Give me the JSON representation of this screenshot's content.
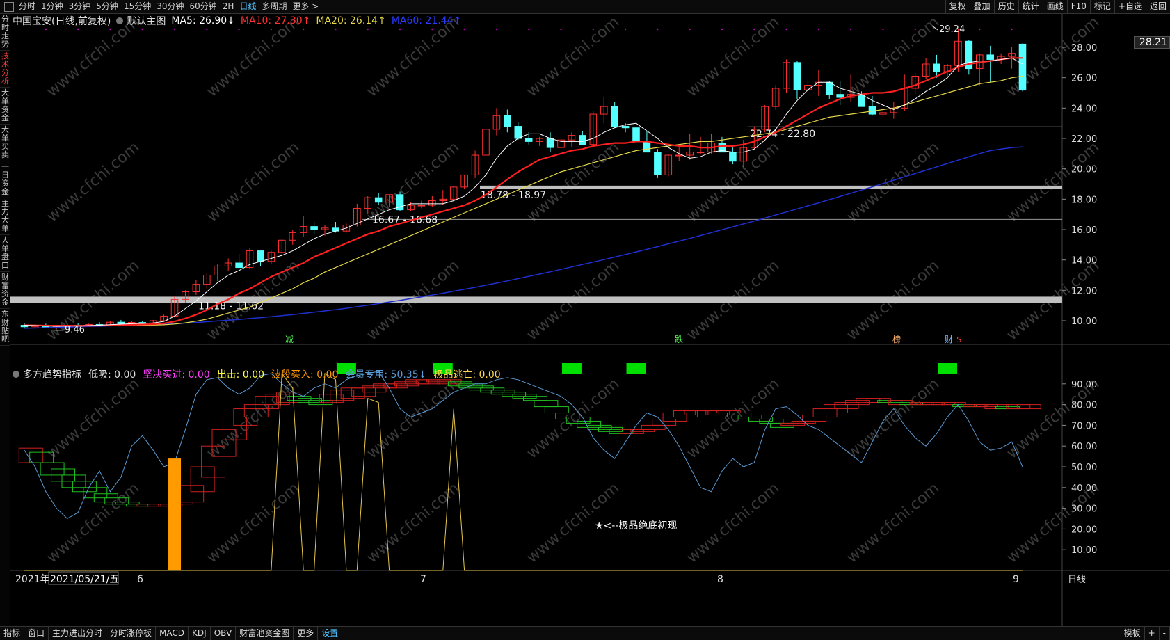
{
  "toolbar": {
    "periods": [
      "分时",
      "1分钟",
      "3分钟",
      "5分钟",
      "15分钟",
      "30分钟",
      "60分钟",
      "2H",
      "日线",
      "多周期",
      "更多 >"
    ],
    "active_period": "日线",
    "tools": [
      "复权",
      "叠加",
      "历史",
      "统计",
      "画线",
      "F10",
      "标记",
      "+自选",
      "返回"
    ]
  },
  "left_nav": [
    "分时走势",
    "技术分析",
    "大单资金",
    "大单买卖",
    "一日资金",
    "主力大单",
    "大单盘口",
    "财富资金",
    "东财贴吧"
  ],
  "left_nav_active": "技术分析",
  "main_legend": {
    "title": "中国宝安(日线,前复权)",
    "overlay": "默认主图",
    "ma5": "MA5: 26.90↓",
    "ma10": "MA10: 27.30↑",
    "ma20": "MA20: 26.14↑",
    "ma60": "MA60: 21.44↑"
  },
  "sub_legend": {
    "name": "多方趋势指标",
    "low": "低吸: 0.00",
    "firm_buy": "坚决买进: 0.00",
    "exit": "出击: 0.00",
    "wave_buy": "波段买入: 0.00",
    "member": "会员专用: 50.35↓",
    "escape": "极品逃亡: 0.00"
  },
  "last_price": "28.21",
  "colors": {
    "up": "#ff3030",
    "down": "#54ffff",
    "ma5": "#ffffff",
    "ma10": "#ff2020",
    "ma20": "#e6d84a",
    "ma60": "#1f2fd0",
    "orange": "#ff9a00",
    "green": "#00e000",
    "blue": "#5b9bd5"
  },
  "price_axis": [
    "28.00",
    "26.00",
    "24.00",
    "22.00",
    "20.00",
    "18.00",
    "16.00",
    "14.00",
    "12.00",
    "10.00"
  ],
  "sub_axis": [
    "90.00",
    "80.00",
    "70.00",
    "60.00",
    "50.00",
    "40.00",
    "30.00",
    "20.00",
    "10.00"
  ],
  "date_labels": {
    "start": "2021年",
    "date": "2021/05/21/五",
    "m6": "6",
    "m7": "7",
    "m8": "8",
    "m9": "9",
    "period": "日线"
  },
  "range_labels": [
    "11.18 - 11.62",
    "16.67 - 16.68",
    "18.78 - 18.97",
    "22.74 - 22.80"
  ],
  "extrema": {
    "high": "29.24",
    "low": "9.46"
  },
  "event_markers": [
    "减",
    "跌",
    "榜",
    "财",
    "$"
  ],
  "annotation": "★<--极品绝底初现",
  "watermark": "www.cfchi.com",
  "bottom_tabs": [
    "指标",
    "窗口",
    "主力进出分时",
    "分时涨停板",
    "MACD",
    "KDJ",
    "OBV",
    "财富池资金图",
    "更多",
    "设置"
  ],
  "bottom_active": "设置",
  "bottom_right": [
    "模板",
    "+",
    "-"
  ],
  "chart_data": {
    "type": "candlestick",
    "candles": [
      [
        9.7,
        9.85,
        9.55,
        9.6
      ],
      [
        9.6,
        9.75,
        9.5,
        9.7
      ],
      [
        9.7,
        9.8,
        9.5,
        9.55
      ],
      [
        9.55,
        9.7,
        9.46,
        9.62
      ],
      [
        9.62,
        9.78,
        9.55,
        9.7
      ],
      [
        9.7,
        9.82,
        9.6,
        9.66
      ],
      [
        9.66,
        9.8,
        9.6,
        9.75
      ],
      [
        9.75,
        9.9,
        9.65,
        9.72
      ],
      [
        9.72,
        9.95,
        9.68,
        9.9
      ],
      [
        9.9,
        10.05,
        9.75,
        9.8
      ],
      [
        9.8,
        9.95,
        9.7,
        9.88
      ],
      [
        9.88,
        10.0,
        9.75,
        9.82
      ],
      [
        9.82,
        10.05,
        9.8,
        10.0
      ],
      [
        10.0,
        10.4,
        9.95,
        10.3
      ],
      [
        10.3,
        11.6,
        10.2,
        11.4
      ],
      [
        11.4,
        12.0,
        11.2,
        11.9
      ],
      [
        11.9,
        12.7,
        11.7,
        12.4
      ],
      [
        12.4,
        13.1,
        12.1,
        13.0
      ],
      [
        13.0,
        13.7,
        12.6,
        13.6
      ],
      [
        13.6,
        14.1,
        13.3,
        13.8
      ],
      [
        13.8,
        14.4,
        13.5,
        13.5
      ],
      [
        13.5,
        14.8,
        13.4,
        14.6
      ],
      [
        14.6,
        14.6,
        13.6,
        13.9
      ],
      [
        13.9,
        14.6,
        13.7,
        14.5
      ],
      [
        14.5,
        15.4,
        14.3,
        15.3
      ],
      [
        15.3,
        16.0,
        15.0,
        15.8
      ],
      [
        15.8,
        16.9,
        15.5,
        16.2
      ],
      [
        16.2,
        16.5,
        15.7,
        16.0
      ],
      [
        16.0,
        16.3,
        15.6,
        16.1
      ],
      [
        16.1,
        16.5,
        15.8,
        15.9
      ],
      [
        15.9,
        16.4,
        15.8,
        16.3
      ],
      [
        16.3,
        17.7,
        16.2,
        17.4
      ],
      [
        17.4,
        18.2,
        17.0,
        18.1
      ],
      [
        18.1,
        18.4,
        17.6,
        17.8
      ],
      [
        17.8,
        18.3,
        17.5,
        18.3
      ],
      [
        18.3,
        18.5,
        17.2,
        17.3
      ],
      [
        17.3,
        17.8,
        17.2,
        17.6
      ],
      [
        17.6,
        17.9,
        17.4,
        17.6
      ],
      [
        17.6,
        18.2,
        17.5,
        17.9
      ],
      [
        17.9,
        18.6,
        17.6,
        18.0
      ],
      [
        18.0,
        18.9,
        17.8,
        18.8
      ],
      [
        18.8,
        19.6,
        18.7,
        19.6
      ],
      [
        19.6,
        21.2,
        19.4,
        20.9
      ],
      [
        20.9,
        23.0,
        20.6,
        22.6
      ],
      [
        22.6,
        24.0,
        22.2,
        23.5
      ],
      [
        23.5,
        23.9,
        22.4,
        22.8
      ],
      [
        22.8,
        23.1,
        21.9,
        22.0
      ],
      [
        22.0,
        22.4,
        21.6,
        21.8
      ],
      [
        21.8,
        22.1,
        21.5,
        22.0
      ],
      [
        22.0,
        22.4,
        21.1,
        21.4
      ],
      [
        21.4,
        22.2,
        20.8,
        21.9
      ],
      [
        21.9,
        22.4,
        21.4,
        22.2
      ],
      [
        22.2,
        22.5,
        21.6,
        21.6
      ],
      [
        21.6,
        23.8,
        21.4,
        23.6
      ],
      [
        23.6,
        24.7,
        23.0,
        24.1
      ],
      [
        24.1,
        24.4,
        22.7,
        22.8
      ],
      [
        22.8,
        23.0,
        22.4,
        22.7
      ],
      [
        22.7,
        23.2,
        21.6,
        21.8
      ],
      [
        21.8,
        22.5,
        21.1,
        21.1
      ],
      [
        21.1,
        21.3,
        19.4,
        19.6
      ],
      [
        19.6,
        21.0,
        19.5,
        20.9
      ],
      [
        20.9,
        21.4,
        20.5,
        20.9
      ],
      [
        20.9,
        22.3,
        20.6,
        21.1
      ],
      [
        21.1,
        22.1,
        21.0,
        21.1
      ],
      [
        21.1,
        22.3,
        21.0,
        21.7
      ],
      [
        21.7,
        22.1,
        21.1,
        21.1
      ],
      [
        21.1,
        21.4,
        20.3,
        20.5
      ],
      [
        20.5,
        21.9,
        20.0,
        21.4
      ],
      [
        21.4,
        22.8,
        21.3,
        22.6
      ],
      [
        22.6,
        24.2,
        22.4,
        24.1
      ],
      [
        24.1,
        25.5,
        23.9,
        25.3
      ],
      [
        25.3,
        27.2,
        25.0,
        27.0
      ],
      [
        27.0,
        27.1,
        24.6,
        25.2
      ],
      [
        25.2,
        25.9,
        25.0,
        25.5
      ],
      [
        25.5,
        26.5,
        24.8,
        25.7
      ],
      [
        25.7,
        25.8,
        24.6,
        24.9
      ],
      [
        24.9,
        25.8,
        24.2,
        24.7
      ],
      [
        24.7,
        26.2,
        24.4,
        24.9
      ],
      [
        24.9,
        25.1,
        24.1,
        24.1
      ],
      [
        24.1,
        24.8,
        23.5,
        23.6
      ],
      [
        23.6,
        23.8,
        23.4,
        23.7
      ],
      [
        23.7,
        24.4,
        23.3,
        24.0
      ],
      [
        24.0,
        26.2,
        23.8,
        25.3
      ],
      [
        25.3,
        26.3,
        24.9,
        26.1
      ],
      [
        26.1,
        27.3,
        25.9,
        26.9
      ],
      [
        26.9,
        27.5,
        26.0,
        26.4
      ],
      [
        26.4,
        26.9,
        26.0,
        26.8
      ],
      [
        26.8,
        29.24,
        26.4,
        28.4
      ],
      [
        28.4,
        28.5,
        26.2,
        26.6
      ],
      [
        26.6,
        27.6,
        25.5,
        27.5
      ],
      [
        27.5,
        28.1,
        25.7,
        27.2
      ],
      [
        27.2,
        27.6,
        26.9,
        27.4
      ],
      [
        27.4,
        28.0,
        26.6,
        27.6
      ],
      [
        28.21,
        28.25,
        25.1,
        25.2
      ]
    ],
    "ma5": [
      9.7,
      9.68,
      9.65,
      9.63,
      9.64,
      9.65,
      9.68,
      9.7,
      9.74,
      9.77,
      9.8,
      9.82,
      9.85,
      9.95,
      10.3,
      10.8,
      11.3,
      11.9,
      12.5,
      13.0,
      13.3,
      13.7,
      13.9,
      14.1,
      14.3,
      14.6,
      15.0,
      15.4,
      15.7,
      15.9,
      16.1,
      16.4,
      16.7,
      17.0,
      17.3,
      17.5,
      17.7,
      17.7,
      17.7,
      17.7,
      17.9,
      18.2,
      18.8,
      19.6,
      20.7,
      21.5,
      22.0,
      22.3,
      22.3,
      22.0,
      21.8,
      21.8,
      21.8,
      22.0,
      22.4,
      22.7,
      22.9,
      23.0,
      22.5,
      22.0,
      21.4,
      21.0,
      20.7,
      20.8,
      21.1,
      21.2,
      21.1,
      21.1,
      21.3,
      21.9,
      22.6,
      23.6,
      24.5,
      25.2,
      25.7,
      25.7,
      25.3,
      25.1,
      24.9,
      24.5,
      24.2,
      23.9,
      24.2,
      24.6,
      25.1,
      25.5,
      26.0,
      26.8,
      27.0,
      27.1,
      27.1,
      27.2,
      27.3,
      26.9
    ],
    "ma10": [
      9.7,
      9.69,
      9.68,
      9.67,
      9.67,
      9.66,
      9.67,
      9.68,
      9.7,
      9.71,
      9.73,
      9.75,
      9.77,
      9.82,
      9.95,
      10.15,
      10.4,
      10.7,
      11.1,
      11.4,
      11.8,
      12.1,
      12.5,
      12.9,
      13.2,
      13.5,
      13.8,
      14.2,
      14.5,
      14.8,
      15.1,
      15.4,
      15.7,
      15.9,
      16.2,
      16.4,
      16.6,
      16.8,
      17.0,
      17.2,
      17.4,
      17.6,
      17.9,
      18.3,
      18.8,
      19.3,
      19.8,
      20.2,
      20.6,
      20.8,
      21.0,
      21.2,
      21.3,
      21.5,
      21.6,
      21.7,
      21.7,
      21.8,
      21.8,
      21.7,
      21.6,
      21.5,
      21.5,
      21.4,
      21.4,
      21.5,
      21.5,
      21.6,
      21.8,
      22.1,
      22.4,
      22.8,
      23.2,
      23.6,
      24.0,
      24.3,
      24.6,
      24.8,
      24.9,
      25.0,
      25.0,
      25.1,
      25.3,
      25.5,
      25.8,
      26.1,
      26.4,
      26.7,
      26.9,
      27.0,
      27.1,
      27.2,
      27.3,
      27.3
    ],
    "ma20": [
      9.7,
      9.7,
      9.69,
      9.69,
      9.68,
      9.68,
      9.68,
      9.68,
      9.69,
      9.69,
      9.7,
      9.7,
      9.71,
      9.73,
      9.78,
      9.86,
      9.97,
      10.1,
      10.3,
      10.5,
      10.7,
      10.9,
      11.2,
      11.5,
      11.8,
      12.1,
      12.5,
      12.8,
      13.2,
      13.5,
      13.8,
      14.1,
      14.4,
      14.7,
      15.0,
      15.3,
      15.6,
      15.9,
      16.2,
      16.5,
      16.8,
      17.1,
      17.4,
      17.7,
      18.0,
      18.3,
      18.6,
      18.9,
      19.2,
      19.5,
      19.8,
      20.0,
      20.2,
      20.4,
      20.6,
      20.8,
      21.0,
      21.2,
      21.3,
      21.4,
      21.5,
      21.6,
      21.7,
      21.8,
      21.8,
      21.9,
      22.0,
      22.1,
      22.2,
      22.3,
      22.4,
      22.6,
      22.8,
      23.0,
      23.2,
      23.4,
      23.5,
      23.6,
      23.7,
      23.8,
      23.9,
      24.0,
      24.2,
      24.4,
      24.6,
      24.8,
      25.0,
      25.2,
      25.4,
      25.6,
      25.7,
      25.8,
      26.0,
      26.1
    ],
    "ma60": [
      9.5,
      9.52,
      9.54,
      9.56,
      9.58,
      9.6,
      9.62,
      9.64,
      9.66,
      9.68,
      9.7,
      9.72,
      9.74,
      9.77,
      9.8,
      9.84,
      9.88,
      9.93,
      9.98,
      10.03,
      10.08,
      10.14,
      10.2,
      10.26,
      10.33,
      10.4,
      10.48,
      10.56,
      10.64,
      10.73,
      10.82,
      10.92,
      11.02,
      11.12,
      11.23,
      11.34,
      11.45,
      11.57,
      11.69,
      11.81,
      11.94,
      12.07,
      12.2,
      12.34,
      12.48,
      12.62,
      12.77,
      12.92,
      13.07,
      13.22,
      13.38,
      13.54,
      13.7,
      13.86,
      14.02,
      14.19,
      14.36,
      14.53,
      14.7,
      14.88,
      15.06,
      15.24,
      15.42,
      15.61,
      15.8,
      15.99,
      16.18,
      16.37,
      16.56,
      16.76,
      16.96,
      17.16,
      17.36,
      17.56,
      17.76,
      17.97,
      18.18,
      18.39,
      18.6,
      18.81,
      19.03,
      19.25,
      19.47,
      19.69,
      19.91,
      20.13,
      20.35,
      20.57,
      20.79,
      21.0,
      21.2,
      21.3,
      21.4,
      21.44
    ],
    "sub_blue": [
      58,
      50,
      38,
      30,
      25,
      28,
      40,
      48,
      38,
      45,
      60,
      65,
      58,
      50,
      52,
      68,
      85,
      92,
      93,
      88,
      85,
      88,
      94,
      95,
      90,
      86,
      84,
      88,
      90,
      88,
      92,
      94,
      95,
      96,
      88,
      78,
      74,
      76,
      78,
      82,
      86,
      88,
      90,
      90,
      92,
      93,
      92,
      90,
      88,
      86,
      84,
      80,
      74,
      64,
      58,
      54,
      62,
      70,
      76,
      74,
      68,
      60,
      50,
      40,
      38,
      48,
      54,
      50,
      52,
      68,
      78,
      79,
      75,
      70,
      68,
      64,
      60,
      56,
      52,
      62,
      72,
      78,
      70,
      64,
      60,
      66,
      74,
      80,
      72,
      62,
      58,
      59,
      62,
      50
    ],
    "sub_steps": [
      [
        59,
        52
      ],
      [
        57,
        52
      ],
      [
        52,
        46
      ],
      [
        49,
        43
      ],
      [
        46,
        40
      ],
      [
        43,
        38
      ],
      [
        40,
        35
      ],
      [
        37,
        33
      ],
      [
        35,
        32
      ],
      [
        33,
        32
      ],
      [
        32,
        31
      ],
      [
        32,
        31
      ],
      [
        32,
        31
      ],
      [
        32,
        31
      ],
      [
        33,
        32
      ],
      [
        41,
        33
      ],
      [
        50,
        38
      ],
      [
        60,
        45
      ],
      [
        68,
        55
      ],
      [
        74,
        63
      ],
      [
        78,
        70
      ],
      [
        80,
        74
      ],
      [
        84,
        78
      ],
      [
        85,
        80
      ],
      [
        86,
        81
      ],
      [
        84,
        82
      ],
      [
        83,
        81
      ],
      [
        82,
        80
      ],
      [
        85,
        81
      ],
      [
        87,
        82
      ],
      [
        88,
        83
      ],
      [
        88,
        84
      ],
      [
        89,
        86
      ],
      [
        90,
        88
      ],
      [
        90,
        88
      ],
      [
        91,
        89
      ],
      [
        92,
        90
      ],
      [
        92,
        90
      ],
      [
        92,
        91
      ],
      [
        92,
        90
      ],
      [
        91,
        89
      ],
      [
        90,
        88
      ],
      [
        89,
        87
      ],
      [
        88,
        86
      ],
      [
        87,
        85
      ],
      [
        86,
        84
      ],
      [
        85,
        83
      ],
      [
        84,
        82
      ],
      [
        82,
        79
      ],
      [
        79,
        76
      ],
      [
        76,
        73
      ],
      [
        74,
        71
      ],
      [
        72,
        69
      ],
      [
        70,
        68
      ],
      [
        69,
        67
      ],
      [
        68,
        66
      ],
      [
        68,
        66
      ],
      [
        68,
        67
      ],
      [
        70,
        68
      ],
      [
        73,
        70
      ],
      [
        76,
        72
      ],
      [
        77,
        74
      ],
      [
        77,
        75
      ],
      [
        77,
        75
      ],
      [
        77,
        75
      ],
      [
        77,
        76
      ],
      [
        76,
        74
      ],
      [
        75,
        73
      ],
      [
        74,
        72
      ],
      [
        73,
        71
      ],
      [
        71,
        69
      ],
      [
        71,
        70
      ],
      [
        72,
        71
      ],
      [
        75,
        72
      ],
      [
        78,
        74
      ],
      [
        80,
        76
      ],
      [
        81,
        78
      ],
      [
        82,
        80
      ],
      [
        83,
        81
      ],
      [
        83,
        81
      ],
      [
        82,
        81
      ],
      [
        82,
        80
      ],
      [
        81,
        80
      ],
      [
        81,
        80
      ],
      [
        81,
        80
      ],
      [
        81,
        80
      ],
      [
        81,
        80
      ],
      [
        80,
        79
      ],
      [
        80,
        79
      ],
      [
        80,
        79
      ],
      [
        80,
        78
      ],
      [
        79,
        78
      ],
      [
        80,
        78
      ],
      [
        80,
        78
      ]
    ],
    "sub_yellow": [
      0,
      0,
      0,
      0,
      0,
      0,
      0,
      0,
      0,
      0,
      0,
      0,
      0,
      0,
      0,
      0,
      0,
      0,
      0,
      0,
      0,
      0,
      0,
      0,
      95,
      88,
      0,
      0,
      95,
      92,
      0,
      0,
      83,
      81,
      0,
      0,
      0,
      0,
      0,
      0,
      78,
      0,
      0,
      0,
      0,
      0,
      0,
      0,
      0,
      0,
      0,
      0,
      0,
      0,
      0,
      0,
      0,
      0,
      0,
      0,
      0,
      0,
      0,
      0,
      0,
      0,
      0,
      0,
      0,
      0,
      0,
      0,
      0,
      0,
      0,
      0,
      0,
      0,
      0,
      0,
      0,
      0,
      0,
      0,
      0,
      0,
      0,
      0,
      0,
      0,
      0,
      0,
      0,
      0
    ],
    "orange_bar": {
      "index": 14,
      "value": 54
    },
    "green_blocks": [
      30,
      39,
      51,
      57,
      86
    ]
  }
}
